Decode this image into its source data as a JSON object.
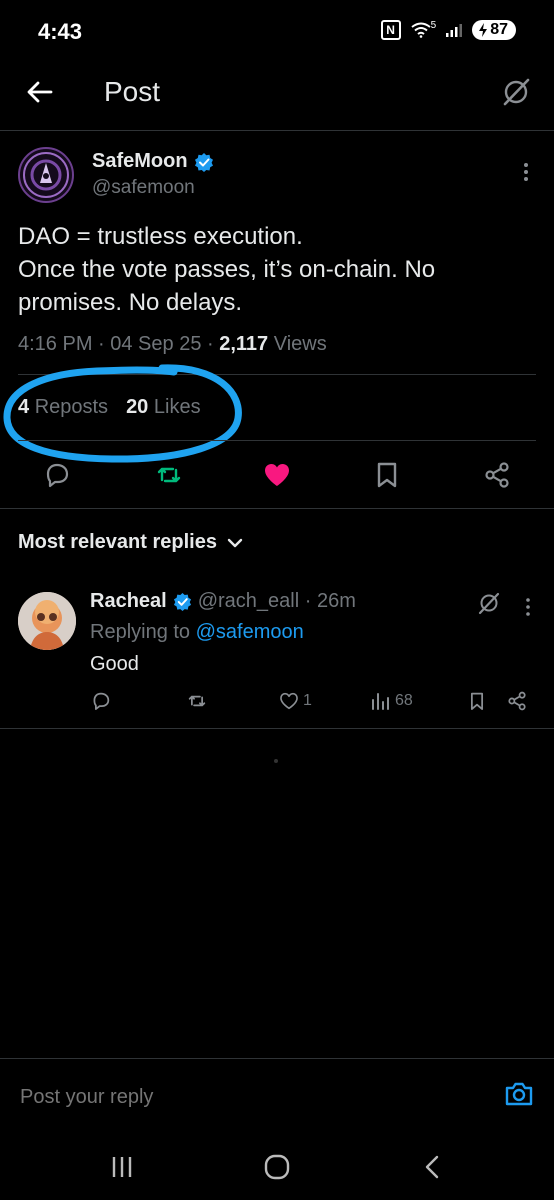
{
  "status": {
    "time": "4:43",
    "nfc": "N",
    "signal": "5",
    "battery": "87"
  },
  "header": {
    "title": "Post"
  },
  "post": {
    "author_name": "SafeMoon",
    "author_handle": "@safemoon",
    "body_lines": [
      "DAO = trustless execution.",
      "Once the vote passes, it’s on-chain. No",
      "promises. No delays."
    ],
    "timestamp": "4:16 PM · 04 Sep 25 · ",
    "views_count": "2,117",
    "views_label": " Views",
    "reposts_count": "4",
    "reposts_label": "Reposts",
    "likes_count": "20",
    "likes_label": "Likes"
  },
  "replies_section": {
    "title": "Most relevant replies"
  },
  "reply": {
    "name": "Racheal",
    "handle_time": "@rach_eall · 26m",
    "replying_prefix": "Replying to ",
    "replying_handle": "@safemoon",
    "text": "Good",
    "likes": "1",
    "views": "68"
  },
  "composer": {
    "placeholder": "Post your reply"
  },
  "colors": {
    "accent": "#1d9bf0",
    "like": "#f91880",
    "repost": "#00ba7c",
    "annotation": "#1fa3f0"
  }
}
